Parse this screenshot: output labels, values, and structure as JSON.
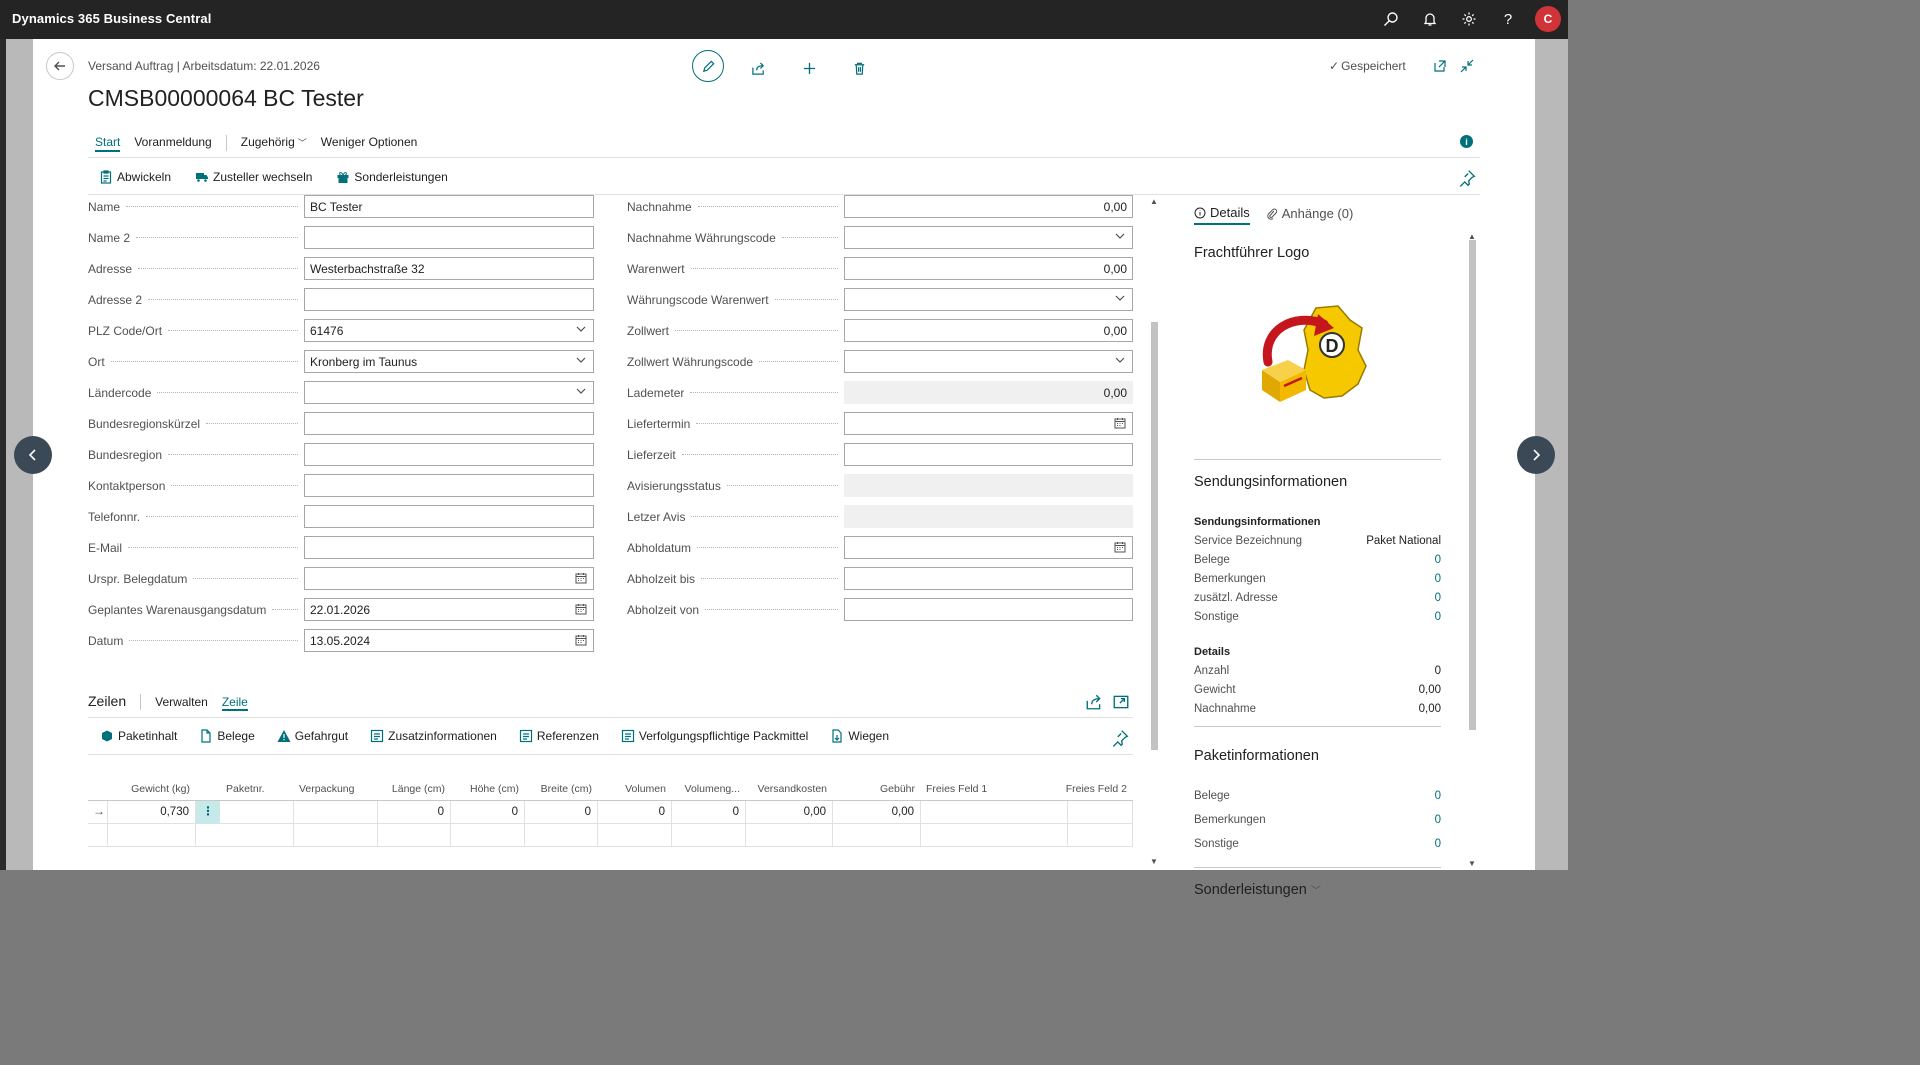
{
  "app": {
    "title": "Dynamics 365 Business Central",
    "avatar_letter": "C"
  },
  "header": {
    "breadcrumb": "Versand Auftrag | Arbeitsdatum: 22.01.2026",
    "title": "CMSB00000064 BC Tester",
    "saved_label": "Gespeichert"
  },
  "tabs": [
    {
      "label": "Start"
    },
    {
      "label": "Voranmeldung"
    },
    {
      "label": "Zugehörig"
    },
    {
      "label": "Weniger Optionen"
    }
  ],
  "actions": [
    {
      "label": "Abwickeln"
    },
    {
      "label": "Zusteller wechseln"
    },
    {
      "label": "Sonderleistungen"
    }
  ],
  "form_left": [
    {
      "label": "Name",
      "value": "BC Tester",
      "kind": "text"
    },
    {
      "label": "Name 2",
      "value": "",
      "kind": "text"
    },
    {
      "label": "Adresse",
      "value": "Westerbachstraße 32",
      "kind": "text"
    },
    {
      "label": "Adresse 2",
      "value": "",
      "kind": "text"
    },
    {
      "label": "PLZ Code/Ort",
      "value": "61476",
      "kind": "dropdown"
    },
    {
      "label": "Ort",
      "value": "Kronberg im Taunus",
      "kind": "dropdown"
    },
    {
      "label": "Ländercode",
      "value": "",
      "kind": "dropdown"
    },
    {
      "label": "Bundesregionskürzel",
      "value": "",
      "kind": "text"
    },
    {
      "label": "Bundesregion",
      "value": "",
      "kind": "text"
    },
    {
      "label": "Kontaktperson",
      "value": "",
      "kind": "text"
    },
    {
      "label": "Telefonnr.",
      "value": "",
      "kind": "text"
    },
    {
      "label": "E-Mail",
      "value": "",
      "kind": "text"
    },
    {
      "label": "Urspr. Belegdatum",
      "value": "",
      "kind": "date"
    },
    {
      "label": "Geplantes Warenausgangsdatum",
      "value": "22.01.2026",
      "kind": "date"
    },
    {
      "label": "Datum",
      "value": "13.05.2024",
      "kind": "date"
    }
  ],
  "form_right": [
    {
      "label": "Nachnahme",
      "value": "0,00",
      "kind": "number"
    },
    {
      "label": "Nachnahme Währungscode",
      "value": "",
      "kind": "dropdown"
    },
    {
      "label": "Warenwert",
      "value": "0,00",
      "kind": "number"
    },
    {
      "label": "Währungscode Warenwert",
      "value": "",
      "kind": "dropdown"
    },
    {
      "label": "Zollwert",
      "value": "0,00",
      "kind": "number"
    },
    {
      "label": "Zollwert Währungscode",
      "value": "",
      "kind": "dropdown"
    },
    {
      "label": "Lademeter",
      "value": "0,00",
      "kind": "readonly-number"
    },
    {
      "label": "Liefertermin",
      "value": "",
      "kind": "date"
    },
    {
      "label": "Lieferzeit",
      "value": "",
      "kind": "text"
    },
    {
      "label": "Avisierungsstatus",
      "value": "",
      "kind": "readonly"
    },
    {
      "label": "Letzer Avis",
      "value": "",
      "kind": "readonly"
    },
    {
      "label": "Abholdatum",
      "value": "",
      "kind": "date"
    },
    {
      "label": "Abholzeit bis",
      "value": "",
      "kind": "text"
    },
    {
      "label": "Abholzeit von",
      "value": "",
      "kind": "text"
    }
  ],
  "lines": {
    "title": "Zeilen",
    "tabs": [
      {
        "label": "Verwalten"
      },
      {
        "label": "Zeile"
      }
    ],
    "actions": [
      {
        "label": "Paketinhalt"
      },
      {
        "label": "Belege"
      },
      {
        "label": "Gefahrgut"
      },
      {
        "label": "Zusatzinformationen"
      },
      {
        "label": "Referenzen"
      },
      {
        "label": "Verfolgungspflichtige Packmittel"
      },
      {
        "label": "Wiegen"
      }
    ],
    "columns": [
      "Gewicht (kg)",
      "Paketnr.",
      "Verpackung",
      "Länge (cm)",
      "Höhe (cm)",
      "Breite (cm)",
      "Volumen",
      "Volumeng...",
      "Versandkosten",
      "Gebühr",
      "Freies Feld 1",
      "Freies Feld 2"
    ],
    "rows": [
      [
        "0,730",
        "",
        "",
        "0",
        "0",
        "0",
        "0",
        "0",
        "0,00",
        "0,00",
        "",
        ""
      ],
      [
        "",
        "",
        "",
        "",
        "",
        "",
        "",
        "",
        "",
        "",
        "",
        ""
      ]
    ],
    "row_marker": "→",
    "row_menu": "⋮"
  },
  "factbox": {
    "tabs": [
      {
        "label": "Details"
      },
      {
        "label": "Anhänge (0)"
      }
    ],
    "logo_heading": "Frachtführer Logo",
    "logo_letter": "D",
    "sendung_heading": "Sendungsinformationen",
    "sendung_sub": "Sendungsinformationen",
    "sendung_rows": [
      {
        "k": "Service Bezeichnung",
        "v": "Paket National",
        "link": false
      },
      {
        "k": "Belege",
        "v": "0",
        "link": true
      },
      {
        "k": "Bemerkungen",
        "v": "0",
        "link": true
      },
      {
        "k": "zusätzl. Adresse",
        "v": "0",
        "link": true
      },
      {
        "k": "Sonstige",
        "v": "0",
        "link": true
      }
    ],
    "details_sub": "Details",
    "details_rows": [
      {
        "k": "Anzahl",
        "v": "0",
        "link": false
      },
      {
        "k": "Gewicht",
        "v": "0,00",
        "link": false
      },
      {
        "k": "Nachnahme",
        "v": "0,00",
        "link": false
      }
    ],
    "paket_heading": "Paketinformationen",
    "paket_rows": [
      {
        "k": "Belege",
        "v": "0",
        "link": true
      },
      {
        "k": "Bemerkungen",
        "v": "0",
        "link": true
      },
      {
        "k": "Sonstige",
        "v": "0",
        "link": true
      }
    ],
    "sonder_heading": "Sonderleistungen"
  },
  "colors": {
    "accent": "#00707a",
    "topbar": "#242424",
    "avatar": "#d13438"
  }
}
